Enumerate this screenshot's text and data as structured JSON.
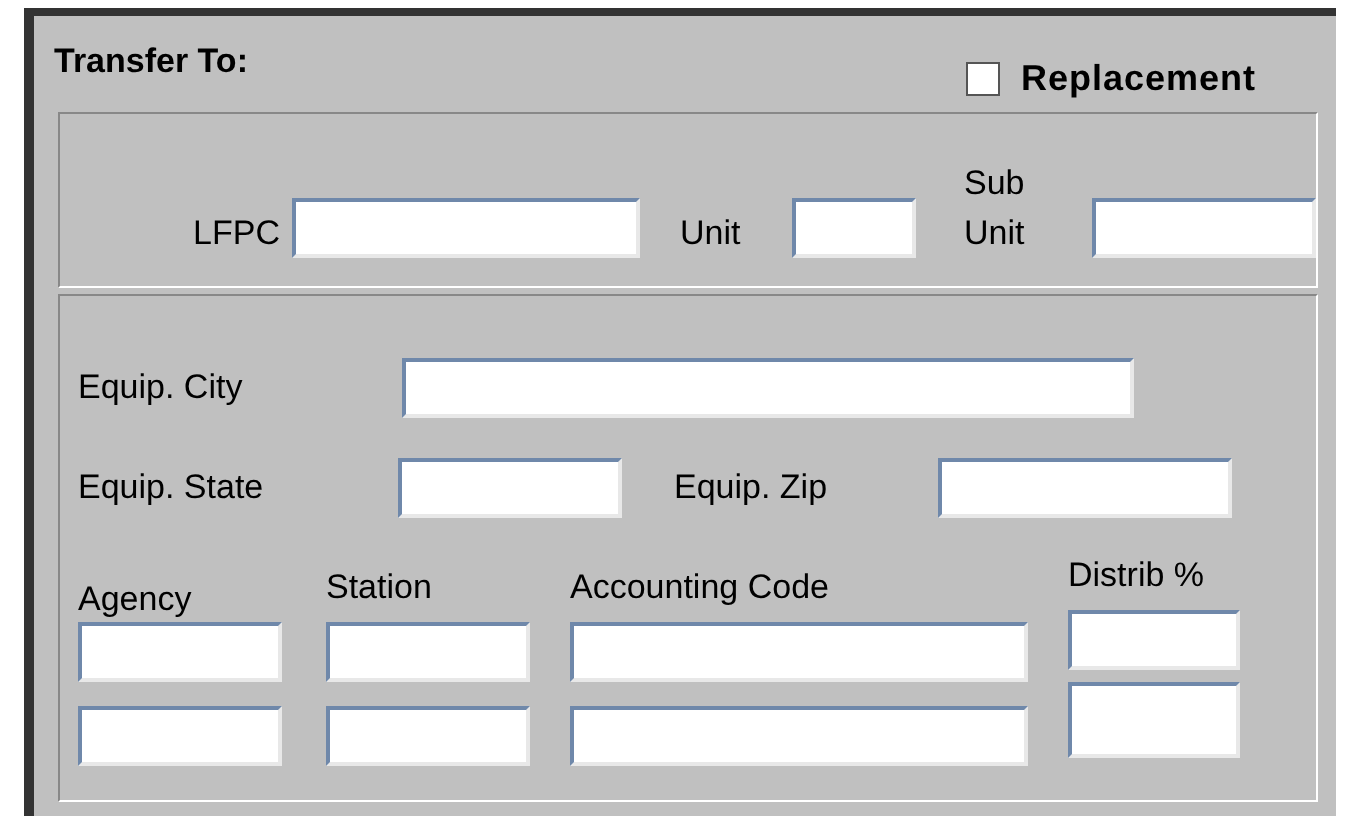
{
  "section": {
    "title": "Transfer To:"
  },
  "replacement": {
    "label": "Replacement",
    "checked": false
  },
  "unit_fields": [
    {
      "label": "LFPC"
    },
    {
      "label": "Unit"
    },
    {
      "label": "Sub Unit"
    }
  ],
  "equipment": {
    "city_label": "Equip. City",
    "state_label": "Equip. State",
    "zip_label": "Equip. Zip"
  },
  "distribution": {
    "columns": [
      "Agency",
      "Station",
      "Accounting Code",
      "Distrib %"
    ],
    "rows": [
      {
        "kind": "entry"
      },
      {
        "kind": "entry"
      }
    ]
  }
}
